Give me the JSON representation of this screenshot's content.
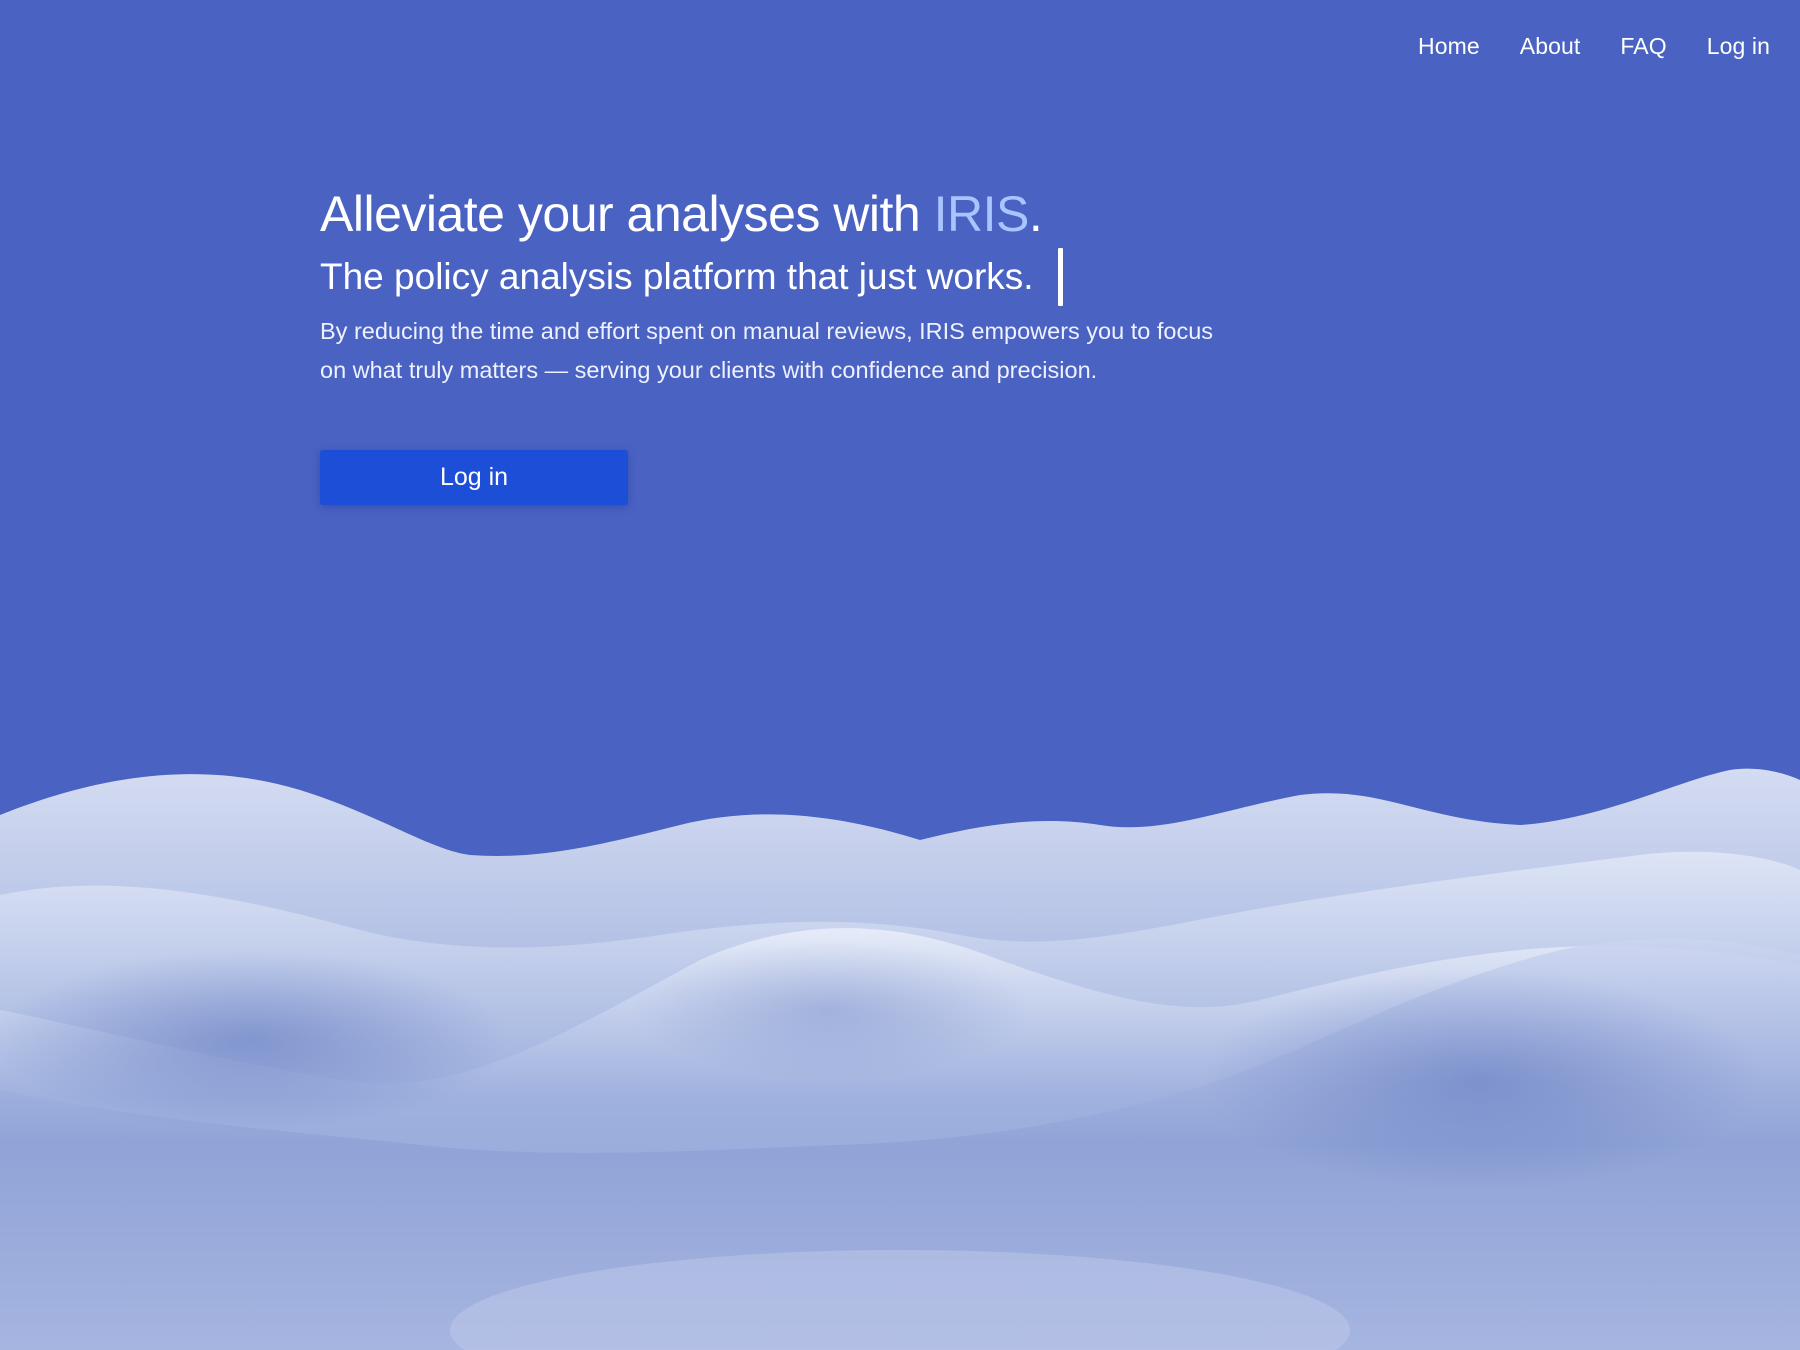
{
  "nav": {
    "items": [
      {
        "label": "Home"
      },
      {
        "label": "About"
      },
      {
        "label": "FAQ"
      },
      {
        "label": "Log in"
      }
    ]
  },
  "hero": {
    "title_prefix": "Alleviate your analyses with ",
    "brand": "IRIS",
    "title_suffix": ".",
    "subtitle": "The policy analysis platform that just works.",
    "description": "By reducing the time and effort spent on manual reviews, IRIS empowers you to focus on what truly matters — serving your clients with confidence and precision.",
    "cta_label": "Log in"
  },
  "colors": {
    "background": "#4a62c1",
    "brand_accent": "#a9c4ff",
    "button": "#1d4ed8"
  }
}
